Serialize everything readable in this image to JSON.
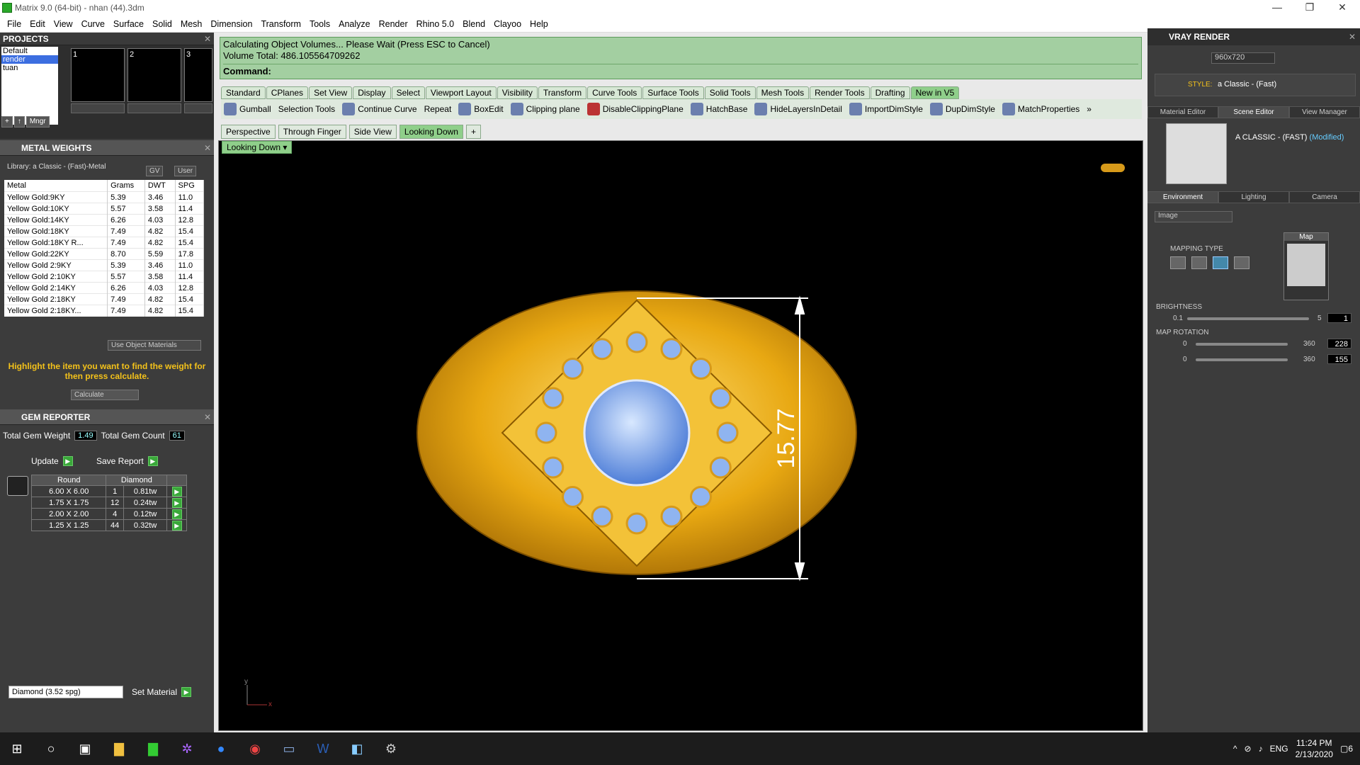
{
  "window": {
    "title": "Matrix 9.0 (64-bit) - nhan (44).3dm",
    "minimize": "—",
    "restore": "❐",
    "close": "✕"
  },
  "menu": [
    "File",
    "Edit",
    "View",
    "Curve",
    "Surface",
    "Solid",
    "Mesh",
    "Dimension",
    "Transform",
    "Tools",
    "Analyze",
    "Render",
    "Rhino 5.0",
    "Blend",
    "Clayoo",
    "Help"
  ],
  "projects": {
    "title": "PROJECTS",
    "items": [
      "Default",
      "render",
      "tuan"
    ],
    "thumbs": [
      "1",
      "2",
      "3"
    ],
    "mgr_label": "Mngr"
  },
  "metal": {
    "title": "METAL WEIGHTS",
    "library": "Library: a Classic - (Fast)-Metal",
    "gv": "GV",
    "user": "User",
    "columns": [
      "Metal",
      "Grams",
      "DWT",
      "SPG"
    ],
    "rows": [
      [
        "Yellow Gold:9KY",
        "5.39",
        "3.46",
        "11.0"
      ],
      [
        "Yellow Gold:10KY",
        "5.57",
        "3.58",
        "11.4"
      ],
      [
        "Yellow Gold:14KY",
        "6.26",
        "4.03",
        "12.8"
      ],
      [
        "Yellow Gold:18KY",
        "7.49",
        "4.82",
        "15.4"
      ],
      [
        "Yellow Gold:18KY R...",
        "7.49",
        "4.82",
        "15.4"
      ],
      [
        "Yellow Gold:22KY",
        "8.70",
        "5.59",
        "17.8"
      ],
      [
        "Yellow Gold 2:9KY",
        "5.39",
        "3.46",
        "11.0"
      ],
      [
        "Yellow Gold 2:10KY",
        "5.57",
        "3.58",
        "11.4"
      ],
      [
        "Yellow Gold 2:14KY",
        "6.26",
        "4.03",
        "12.8"
      ],
      [
        "Yellow Gold 2:18KY",
        "7.49",
        "4.82",
        "15.4"
      ],
      [
        "Yellow Gold 2:18KY...",
        "7.49",
        "4.82",
        "15.4"
      ]
    ],
    "use_object_materials": "Use Object Materials",
    "note": "Highlight the item you want to find the weight for then press calculate.",
    "calculate": "Calculate"
  },
  "gem": {
    "title": "GEM REPORTER",
    "total_weight_label": "Total Gem Weight",
    "total_weight": "1.49",
    "total_count_label": "Total Gem Count",
    "total_count": "61",
    "update": "Update",
    "save_report": "Save Report",
    "columns": [
      "Round",
      "Diamond"
    ],
    "rows": [
      [
        "6.00 X 6.00",
        "1",
        "0.81tw"
      ],
      [
        "1.75 X 1.75",
        "12",
        "0.24tw"
      ],
      [
        "2.00 X 2.00",
        "4",
        "0.12tw"
      ],
      [
        "1.25 X 1.25",
        "44",
        "0.32tw"
      ]
    ],
    "material_select": "Diamond     (3.52 spg)",
    "set_material": "Set Material"
  },
  "command": {
    "line1": "Calculating Object Volumes... Please Wait (Press ESC to Cancel)",
    "line2": "Volume Total: 486.105564709262",
    "line3": "Command:"
  },
  "toolbar_tabs": [
    "Standard",
    "CPlanes",
    "Set View",
    "Display",
    "Select",
    "Viewport Layout",
    "Visibility",
    "Transform",
    "Curve Tools",
    "Surface Tools",
    "Solid Tools",
    "Mesh Tools",
    "Render Tools",
    "Drafting",
    "New in V5"
  ],
  "tools": [
    "Gumball",
    "Selection Tools",
    "Continue Curve",
    "Repeat",
    "BoxEdit",
    "Clipping plane",
    "DisableClippingPlane",
    "HatchBase",
    "HideLayersInDetail",
    "ImportDimStyle",
    "DupDimStyle",
    "MatchProperties"
  ],
  "viewport_tabs": [
    "Perspective",
    "Through Finger",
    "Side View",
    "Looking Down"
  ],
  "viewport": {
    "label": "Looking Down",
    "dimension": "15.77",
    "axis_x": "x",
    "axis_y": "y"
  },
  "vray": {
    "title": "VRAY RENDER",
    "resolution": "960x720",
    "style_label": "STYLE:",
    "style_value": "a Classic - (Fast)",
    "tabs": [
      "Material Editor",
      "Scene Editor",
      "View Manager"
    ],
    "scene_name": "A CLASSIC - (FAST)",
    "modified": "(Modified)",
    "env_tabs": [
      "Environment",
      "Lighting",
      "Camera"
    ],
    "env_select": "Image",
    "map_label": "Map",
    "mapping_type": "MAPPING TYPE",
    "brightness": "BRIGHTNESS",
    "brightness_min": "0.1",
    "brightness_max": "5",
    "brightness_val": "1",
    "map_rotation": "MAP ROTATION",
    "rot1_min": "0",
    "rot1_max": "360",
    "rot1_val": "228",
    "rot2_min": "0",
    "rot2_max": "360",
    "rot2_val": "155"
  },
  "taskbar": {
    "lang": "ENG",
    "time": "11:24 PM",
    "date": "2/13/2020",
    "notif": "6"
  }
}
